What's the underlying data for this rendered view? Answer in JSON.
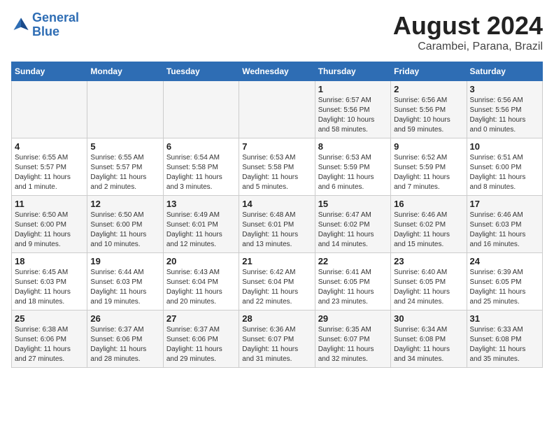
{
  "header": {
    "logo_line1": "General",
    "logo_line2": "Blue",
    "month_year": "August 2024",
    "location": "Carambei, Parana, Brazil"
  },
  "weekdays": [
    "Sunday",
    "Monday",
    "Tuesday",
    "Wednesday",
    "Thursday",
    "Friday",
    "Saturday"
  ],
  "weeks": [
    [
      {
        "day": "",
        "info": ""
      },
      {
        "day": "",
        "info": ""
      },
      {
        "day": "",
        "info": ""
      },
      {
        "day": "",
        "info": ""
      },
      {
        "day": "1",
        "info": "Sunrise: 6:57 AM\nSunset: 5:56 PM\nDaylight: 10 hours\nand 58 minutes."
      },
      {
        "day": "2",
        "info": "Sunrise: 6:56 AM\nSunset: 5:56 PM\nDaylight: 10 hours\nand 59 minutes."
      },
      {
        "day": "3",
        "info": "Sunrise: 6:56 AM\nSunset: 5:56 PM\nDaylight: 11 hours\nand 0 minutes."
      }
    ],
    [
      {
        "day": "4",
        "info": "Sunrise: 6:55 AM\nSunset: 5:57 PM\nDaylight: 11 hours\nand 1 minute."
      },
      {
        "day": "5",
        "info": "Sunrise: 6:55 AM\nSunset: 5:57 PM\nDaylight: 11 hours\nand 2 minutes."
      },
      {
        "day": "6",
        "info": "Sunrise: 6:54 AM\nSunset: 5:58 PM\nDaylight: 11 hours\nand 3 minutes."
      },
      {
        "day": "7",
        "info": "Sunrise: 6:53 AM\nSunset: 5:58 PM\nDaylight: 11 hours\nand 5 minutes."
      },
      {
        "day": "8",
        "info": "Sunrise: 6:53 AM\nSunset: 5:59 PM\nDaylight: 11 hours\nand 6 minutes."
      },
      {
        "day": "9",
        "info": "Sunrise: 6:52 AM\nSunset: 5:59 PM\nDaylight: 11 hours\nand 7 minutes."
      },
      {
        "day": "10",
        "info": "Sunrise: 6:51 AM\nSunset: 6:00 PM\nDaylight: 11 hours\nand 8 minutes."
      }
    ],
    [
      {
        "day": "11",
        "info": "Sunrise: 6:50 AM\nSunset: 6:00 PM\nDaylight: 11 hours\nand 9 minutes."
      },
      {
        "day": "12",
        "info": "Sunrise: 6:50 AM\nSunset: 6:00 PM\nDaylight: 11 hours\nand 10 minutes."
      },
      {
        "day": "13",
        "info": "Sunrise: 6:49 AM\nSunset: 6:01 PM\nDaylight: 11 hours\nand 12 minutes."
      },
      {
        "day": "14",
        "info": "Sunrise: 6:48 AM\nSunset: 6:01 PM\nDaylight: 11 hours\nand 13 minutes."
      },
      {
        "day": "15",
        "info": "Sunrise: 6:47 AM\nSunset: 6:02 PM\nDaylight: 11 hours\nand 14 minutes."
      },
      {
        "day": "16",
        "info": "Sunrise: 6:46 AM\nSunset: 6:02 PM\nDaylight: 11 hours\nand 15 minutes."
      },
      {
        "day": "17",
        "info": "Sunrise: 6:46 AM\nSunset: 6:03 PM\nDaylight: 11 hours\nand 16 minutes."
      }
    ],
    [
      {
        "day": "18",
        "info": "Sunrise: 6:45 AM\nSunset: 6:03 PM\nDaylight: 11 hours\nand 18 minutes."
      },
      {
        "day": "19",
        "info": "Sunrise: 6:44 AM\nSunset: 6:03 PM\nDaylight: 11 hours\nand 19 minutes."
      },
      {
        "day": "20",
        "info": "Sunrise: 6:43 AM\nSunset: 6:04 PM\nDaylight: 11 hours\nand 20 minutes."
      },
      {
        "day": "21",
        "info": "Sunrise: 6:42 AM\nSunset: 6:04 PM\nDaylight: 11 hours\nand 22 minutes."
      },
      {
        "day": "22",
        "info": "Sunrise: 6:41 AM\nSunset: 6:05 PM\nDaylight: 11 hours\nand 23 minutes."
      },
      {
        "day": "23",
        "info": "Sunrise: 6:40 AM\nSunset: 6:05 PM\nDaylight: 11 hours\nand 24 minutes."
      },
      {
        "day": "24",
        "info": "Sunrise: 6:39 AM\nSunset: 6:05 PM\nDaylight: 11 hours\nand 25 minutes."
      }
    ],
    [
      {
        "day": "25",
        "info": "Sunrise: 6:38 AM\nSunset: 6:06 PM\nDaylight: 11 hours\nand 27 minutes."
      },
      {
        "day": "26",
        "info": "Sunrise: 6:37 AM\nSunset: 6:06 PM\nDaylight: 11 hours\nand 28 minutes."
      },
      {
        "day": "27",
        "info": "Sunrise: 6:37 AM\nSunset: 6:06 PM\nDaylight: 11 hours\nand 29 minutes."
      },
      {
        "day": "28",
        "info": "Sunrise: 6:36 AM\nSunset: 6:07 PM\nDaylight: 11 hours\nand 31 minutes."
      },
      {
        "day": "29",
        "info": "Sunrise: 6:35 AM\nSunset: 6:07 PM\nDaylight: 11 hours\nand 32 minutes."
      },
      {
        "day": "30",
        "info": "Sunrise: 6:34 AM\nSunset: 6:08 PM\nDaylight: 11 hours\nand 34 minutes."
      },
      {
        "day": "31",
        "info": "Sunrise: 6:33 AM\nSunset: 6:08 PM\nDaylight: 11 hours\nand 35 minutes."
      }
    ]
  ]
}
